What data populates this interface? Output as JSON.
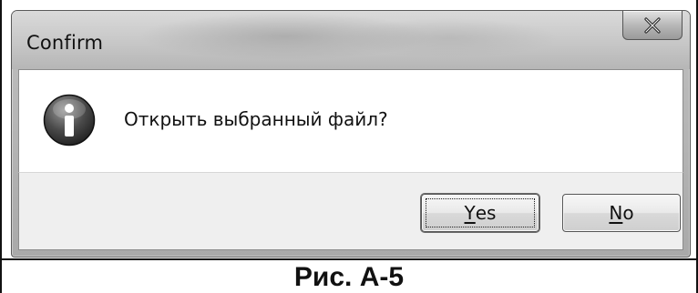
{
  "window": {
    "title": "Confirm",
    "close_icon": "close-icon"
  },
  "content": {
    "icon": "info-icon",
    "message": "Открыть выбранный файл?"
  },
  "buttons": {
    "yes": {
      "accel": "Y",
      "rest": "es"
    },
    "no": {
      "accel": "N",
      "rest": "o"
    }
  },
  "caption": "Рис. А-5"
}
